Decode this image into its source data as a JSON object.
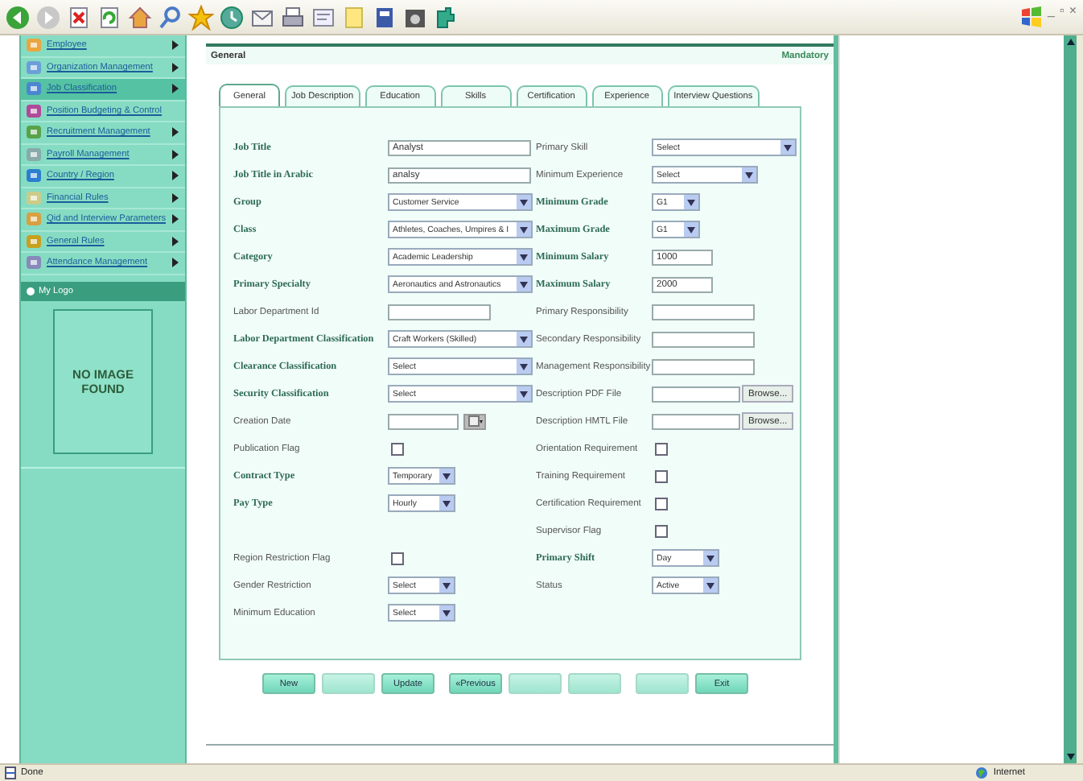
{
  "window": {
    "controls": [
      "_",
      "▫",
      "×"
    ]
  },
  "sidebar": {
    "items": [
      {
        "label": "Employee",
        "submenu": true,
        "selected": false
      },
      {
        "label": "Organization Management",
        "submenu": true,
        "selected": false
      },
      {
        "label": "Job Classification",
        "submenu": true,
        "selected": true
      },
      {
        "label": "Position Budgeting & Control",
        "submenu": false,
        "selected": false
      },
      {
        "label": "Recruitment Management",
        "submenu": true,
        "selected": false
      },
      {
        "label": "Payroll Management",
        "submenu": true,
        "selected": false
      },
      {
        "label": "Country / Region",
        "submenu": true,
        "selected": false
      },
      {
        "label": "Financial Rules",
        "submenu": true,
        "selected": false
      },
      {
        "label": "Qid and Interview Parameters",
        "submenu": true,
        "selected": false
      },
      {
        "label": "General Rules",
        "submenu": true,
        "selected": false
      },
      {
        "label": "Attendance Management",
        "submenu": true,
        "selected": false
      }
    ],
    "logo_header": "My Logo",
    "logo_placeholder": "NO IMAGE FOUND"
  },
  "form": {
    "title": "General",
    "note": "Mandatory",
    "tabs": [
      {
        "label": "General",
        "selected": true
      },
      {
        "label": "Job Description",
        "selected": false
      },
      {
        "label": "Education",
        "selected": false
      },
      {
        "label": "Skills",
        "selected": false
      },
      {
        "label": "Certification",
        "selected": false
      },
      {
        "label": "Experience",
        "selected": false
      },
      {
        "label": "Interview Questions",
        "selected": false
      }
    ],
    "rows": [
      {
        "left": {
          "label": "Job Title",
          "mandatory": true,
          "kind": "text",
          "value": "Analyst"
        },
        "right": {
          "label": "Primary Skill",
          "mandatory": false,
          "kind": "select",
          "value": "Select"
        }
      },
      {
        "left": {
          "label": "Job Title in Arabic",
          "mandatory": true,
          "kind": "text",
          "value": "analsy"
        },
        "right": {
          "label": "Minimum Experience",
          "mandatory": false,
          "kind": "medium-select",
          "value": "Select"
        }
      },
      {
        "left": {
          "label": "Group",
          "mandatory": true,
          "kind": "select",
          "value": "Customer Service"
        },
        "right": {
          "label": "Minimum Grade",
          "mandatory": true,
          "kind": "tiny-select",
          "value": "G1"
        }
      },
      {
        "left": {
          "label": "Class",
          "mandatory": true,
          "kind": "select",
          "value": "Athletes, Coaches, Umpires & I"
        },
        "right": {
          "label": "Maximum Grade",
          "mandatory": true,
          "kind": "tiny-select",
          "value": "G1"
        }
      },
      {
        "left": {
          "label": "Category",
          "mandatory": true,
          "kind": "select",
          "value": "Academic Leadership"
        },
        "right": {
          "label": "Minimum Salary",
          "mandatory": true,
          "kind": "short-text",
          "value": "1000"
        }
      },
      {
        "left": {
          "label": "Primary Specialty",
          "mandatory": true,
          "kind": "select",
          "value": "Aeronautics and Astronautics"
        },
        "right": {
          "label": "Maximum Salary",
          "mandatory": true,
          "kind": "short-text",
          "value": "2000"
        }
      },
      {
        "left": {
          "label": "Labor Department Id",
          "mandatory": false,
          "kind": "medium-text"
        },
        "right": {
          "label": "Primary Responsibility",
          "mandatory": false,
          "kind": "medium-text"
        }
      },
      {
        "left": {
          "label": "Labor Department Classification",
          "mandatory": true,
          "kind": "select",
          "value": "Craft Workers (Skilled)"
        },
        "right": {
          "label": "Secondary Responsibility",
          "mandatory": false,
          "kind": "medium-text"
        }
      },
      {
        "left": {
          "label": "Clearance Classification",
          "mandatory": true,
          "kind": "select",
          "value": "Select"
        },
        "right": {
          "label": "Management Responsibility",
          "mandatory": false,
          "kind": "medium-text"
        }
      },
      {
        "left": {
          "label": "Security Classification",
          "mandatory": true,
          "kind": "select",
          "value": "Select"
        },
        "right": {
          "label": "Description PDF File",
          "mandatory": false,
          "kind": "file",
          "button": "Browse..."
        }
      },
      {
        "left": {
          "label": "Creation Date",
          "mandatory": false,
          "kind": "date"
        },
        "right": {
          "label": "Description HMTL File",
          "mandatory": false,
          "kind": "file",
          "button": "Browse..."
        }
      },
      {
        "left": {
          "label": "Publication Flag",
          "mandatory": false,
          "kind": "checkbox",
          "checked": false
        },
        "right": {
          "label": "Orientation Requirement",
          "mandatory": false,
          "kind": "checkbox",
          "checked": false
        }
      },
      {
        "left": {
          "label": "Contract Type",
          "mandatory": true,
          "kind": "small-select",
          "value": "Temporary"
        },
        "right": {
          "label": "Training Requirement",
          "mandatory": false,
          "kind": "checkbox",
          "checked": false
        }
      },
      {
        "left": {
          "label": "Pay Type",
          "mandatory": true,
          "kind": "small-select",
          "value": "Hourly"
        },
        "right": {
          "label": "Certification Requirement",
          "mandatory": false,
          "kind": "checkbox",
          "checked": false
        }
      },
      {
        "right": {
          "label": "Supervisor Flag",
          "mandatory": false,
          "kind": "checkbox",
          "checked": false
        }
      },
      {
        "left": {
          "label": "Region Restriction Flag",
          "mandatory": false,
          "kind": "checkbox",
          "checked": false
        },
        "right": {
          "label": "Primary Shift",
          "mandatory": true,
          "kind": "small-select",
          "value": "Day"
        }
      },
      {
        "left": {
          "label": "Gender Restriction",
          "mandatory": false,
          "kind": "small-select",
          "value": "Select"
        },
        "right": {
          "label": "Status",
          "mandatory": false,
          "kind": "small-select",
          "value": "Active"
        }
      },
      {
        "left": {
          "label": "Minimum Education",
          "mandatory": false,
          "kind": "small-select",
          "value": "Select"
        }
      }
    ],
    "button_groups": [
      [
        {
          "label": "New",
          "disabled": false
        },
        {
          "disabled": true
        },
        {
          "label": "Update",
          "disabled": false
        }
      ],
      [
        {
          "label": "«Previous",
          "disabled": false
        },
        {
          "disabled": true
        },
        {
          "disabled": true
        }
      ],
      [
        {
          "disabled": true
        },
        {
          "label": "Exit",
          "disabled": false
        }
      ]
    ]
  },
  "status_bar": {
    "text": "Done",
    "zone": "Internet"
  }
}
